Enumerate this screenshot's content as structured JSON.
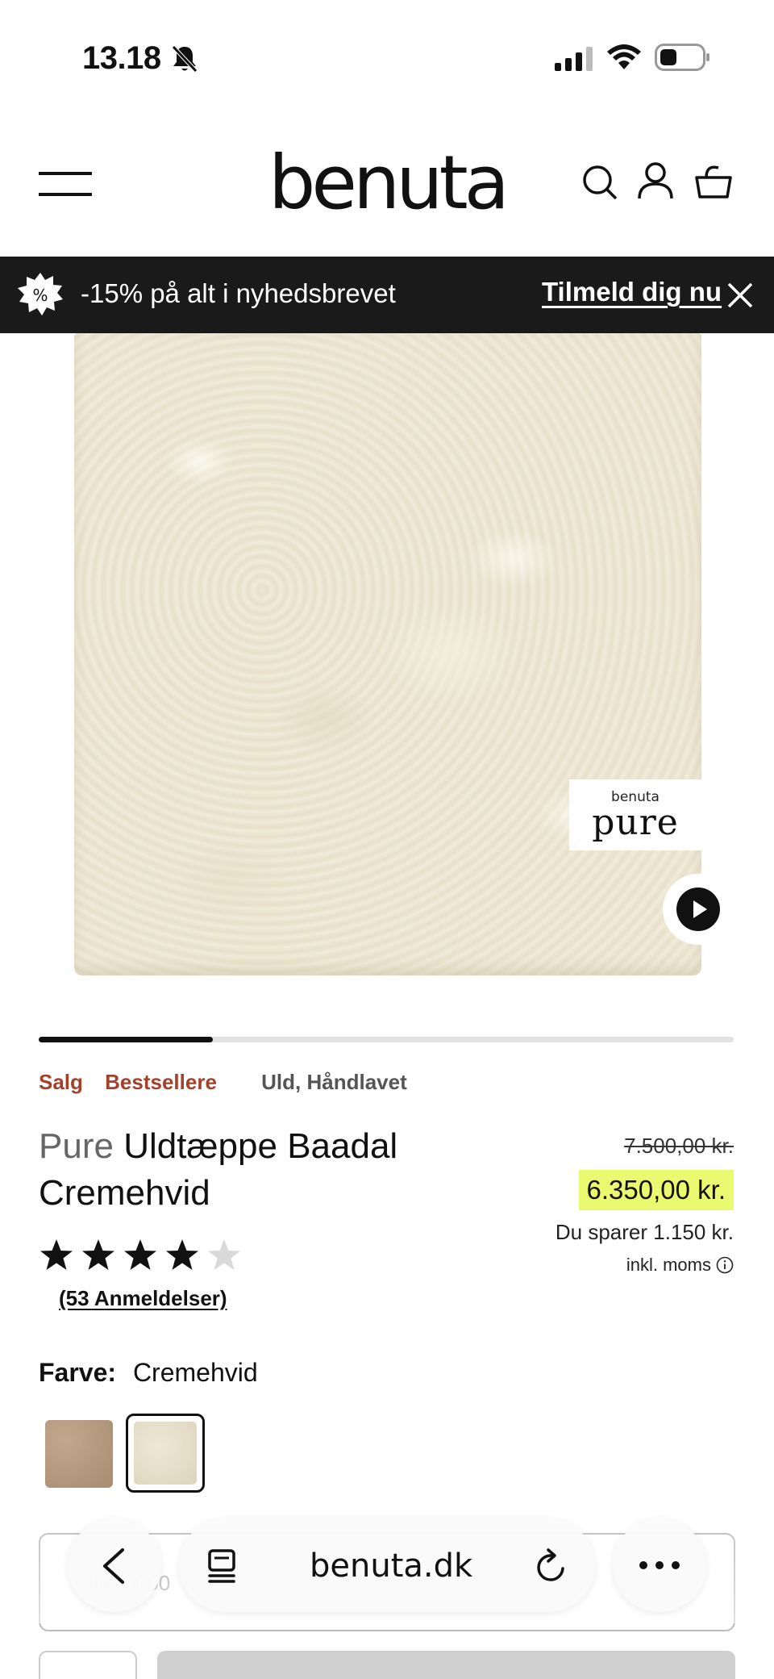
{
  "status_bar": {
    "time": "13.18"
  },
  "header": {
    "logo": "benuta"
  },
  "promo": {
    "text": "-15% på alt i nyhedsbrevet",
    "link": "Tilmeld dig nu",
    "badge_symbol": "%"
  },
  "image": {
    "badge_brand": "benuta",
    "badge_word": "pure"
  },
  "carousel": {
    "current_slide": 1,
    "progress": 0.25
  },
  "tags": {
    "sale": "Salg",
    "bestseller": "Bestsellere",
    "materials": "Uld, Håndlavet"
  },
  "product": {
    "brand": "Pure",
    "name": "Uldtæppe Baadal Cremehvid",
    "old_price": "7.500,00 kr.",
    "price": "6.350,00 kr.",
    "savings": "Du sparer 1.150 kr.",
    "vat": "inkl. moms"
  },
  "rating": {
    "stars": 4,
    "max": 5,
    "reviews": "(53 Anmeldelser)"
  },
  "color": {
    "label": "Farve:",
    "selected": "Cremehvid",
    "swatches": [
      {
        "name": "brown",
        "color": "#b59a7e",
        "selected": false
      },
      {
        "name": "cremehvid",
        "color": "#e8e1cc",
        "selected": true
      }
    ]
  },
  "below": {
    "text": "Ilæ 0000"
  },
  "browser": {
    "url": "benuta.dk"
  },
  "colors": {
    "promo_bg": "#1a1a1a",
    "sale_tag": "#a4412a",
    "price_highlight": "#e9f970"
  }
}
